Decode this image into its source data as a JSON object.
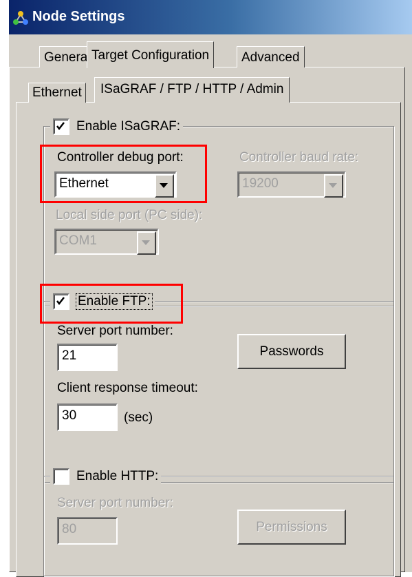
{
  "window": {
    "title": "Node Settings",
    "app_icon": "network-nodes-icon"
  },
  "tabs": [
    {
      "label": "General",
      "active": false
    },
    {
      "label": "Target Configuration",
      "active": true
    },
    {
      "label": "Advanced",
      "active": false
    }
  ],
  "subtabs": [
    {
      "label": "Ethernet",
      "active": false
    },
    {
      "label": "ISaGRAF / FTP / HTTP / Admin",
      "active": true
    }
  ],
  "isagraf": {
    "enable_label": "Enable ISaGRAF:",
    "enabled": true,
    "debug_port_label": "Controller debug port:",
    "debug_port_value": "Ethernet",
    "baud_rate_label": "Controller baud rate:",
    "baud_rate_value": "19200",
    "local_port_label": "Local side port (PC side):",
    "local_port_value": "COM1"
  },
  "ftp": {
    "enable_label": "Enable FTP:",
    "enabled": true,
    "server_port_label": "Server port number:",
    "server_port_value": "21",
    "passwords_button": "Passwords",
    "timeout_label": "Client response timeout:",
    "timeout_value": "30",
    "timeout_unit": "(sec)"
  },
  "http": {
    "enable_label": "Enable HTTP:",
    "enabled": false,
    "server_port_label": "Server port number:",
    "server_port_value": "80",
    "permissions_button": "Permissions"
  },
  "colors": {
    "title_bar": "#0a246a",
    "face": "#d4d0c8",
    "highlight": "#ff0000"
  }
}
